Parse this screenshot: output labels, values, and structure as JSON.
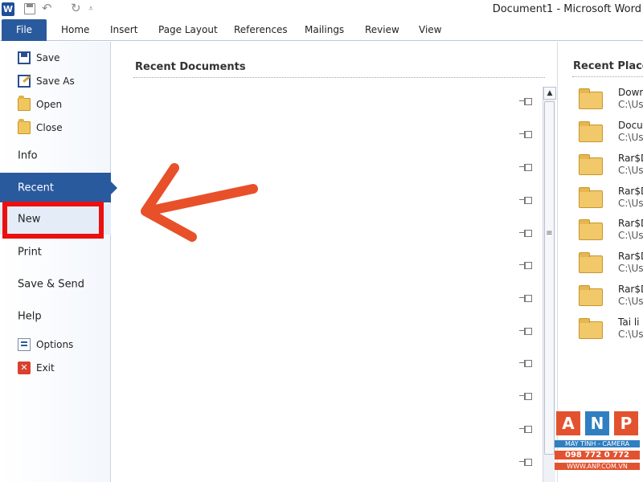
{
  "window": {
    "title": "Document1  -  Microsoft Word",
    "app_icon_label": "W"
  },
  "quick_access": {
    "undo_glyph": "↶",
    "redo_glyph": "↻",
    "customize_glyph": "⩡"
  },
  "tabs": {
    "file": "File",
    "items": [
      "Home",
      "Insert",
      "Page Layout",
      "References",
      "Mailings",
      "Review",
      "View"
    ]
  },
  "menu": {
    "save": "Save",
    "save_as": "Save As",
    "open": "Open",
    "close": "Close",
    "info": "Info",
    "recent": "Recent",
    "new": "New",
    "print": "Print",
    "save_send": "Save & Send",
    "help": "Help",
    "options": "Options",
    "exit": "Exit",
    "exit_glyph": "✕"
  },
  "recent_documents": {
    "title": "Recent Documents"
  },
  "scrollbar": {
    "up_glyph": "▲",
    "grip_glyph": "≡"
  },
  "recent_places": {
    "title": "Recent Places",
    "items": [
      {
        "name": "Down",
        "path": "C:\\Us"
      },
      {
        "name": "Docu",
        "path": "C:\\Us"
      },
      {
        "name": "Rar$D",
        "path": "C:\\Us"
      },
      {
        "name": "Rar$D",
        "path": "C:\\Us"
      },
      {
        "name": "Rar$D",
        "path": "C:\\Us"
      },
      {
        "name": "Rar$D",
        "path": "C:\\Us"
      },
      {
        "name": "Rar$D",
        "path": "C:\\Us"
      },
      {
        "name": "Tai li",
        "path": "C:\\Us"
      }
    ]
  },
  "watermark": {
    "letters": [
      "A",
      "N",
      "P"
    ],
    "tagline": "MÁY TÍNH - CAMERA",
    "phone": "098 772 0 772",
    "site": "WWW.ANP.COM.VN"
  },
  "colors": {
    "accent": "#2a5a9e",
    "highlight": "#ea1010",
    "arrow": "#e8502a",
    "wm_a": "#e3522f",
    "wm_n": "#2f7fc1",
    "wm_p": "#e3522f"
  }
}
